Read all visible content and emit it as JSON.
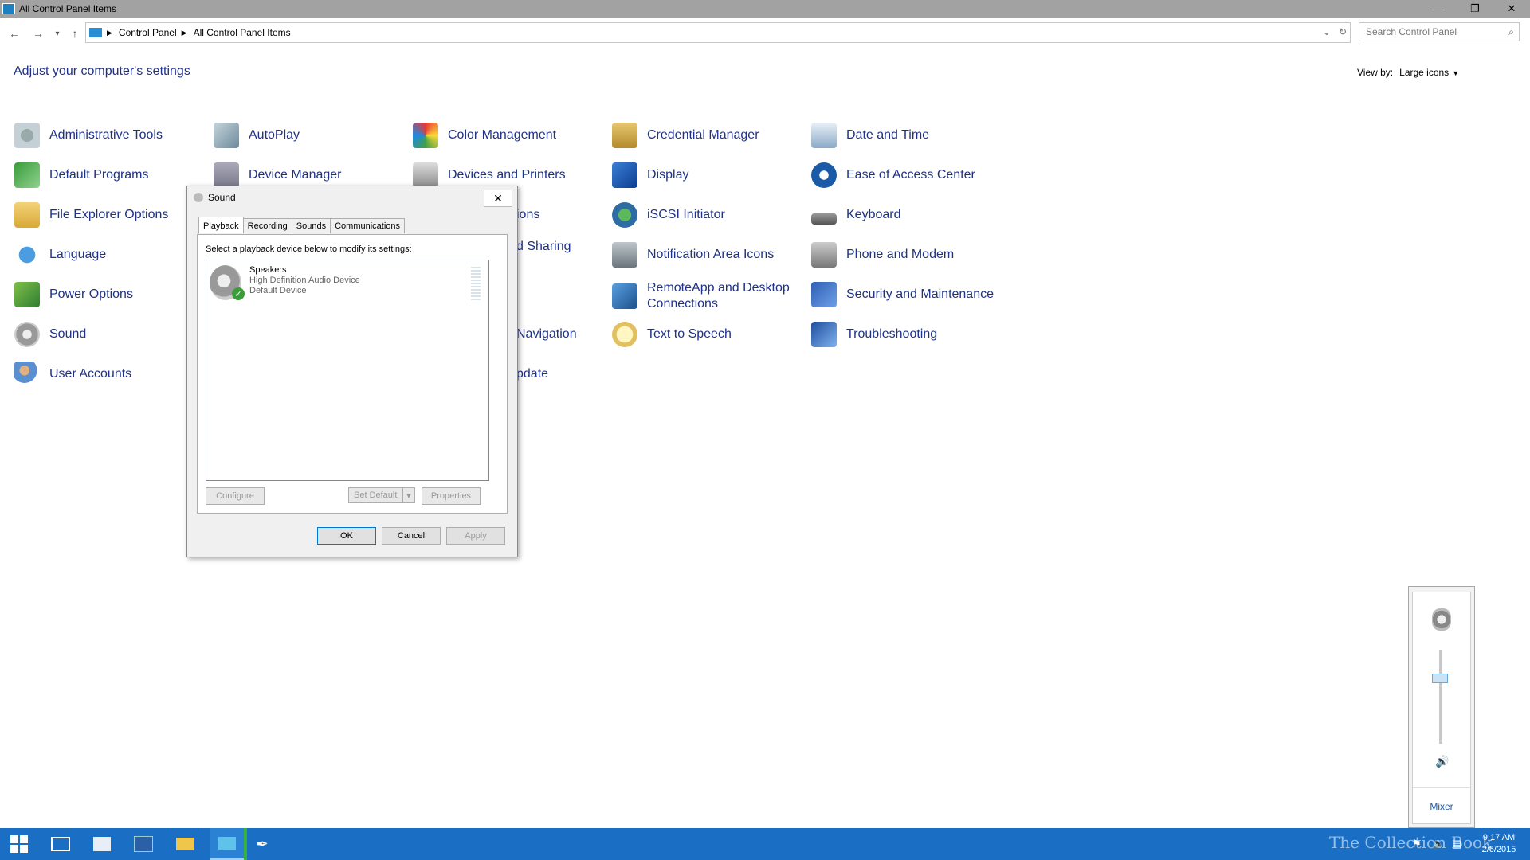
{
  "window": {
    "title": "All Control Panel Items",
    "minimize": "—",
    "restore": "❐",
    "close": "✕"
  },
  "nav": {
    "back": "←",
    "forward": "→",
    "recent": "▾",
    "up": "↑"
  },
  "address": {
    "crumbs": [
      "Control Panel",
      "All Control Panel Items"
    ],
    "dropdown": "⌄",
    "refresh": "↻"
  },
  "search": {
    "placeholder": "Search Control Panel",
    "icon": "⌕"
  },
  "header": {
    "title": "Adjust your computer's settings",
    "view_by_label": "View by:",
    "view_by_value": "Large icons",
    "caret": "▼"
  },
  "items": {
    "administrative_tools": "Administrative Tools",
    "autoplay": "AutoPlay",
    "color_management": "Color Management",
    "credential_manager": "Credential Manager",
    "date_time": "Date and Time",
    "default_programs": "Default Programs",
    "device_manager": "Device Manager",
    "devices_printers": "Devices and Printers",
    "display": "Display",
    "ease_access": "Ease of Access Center",
    "file_explorer_options": "File Explorer Options",
    "partial_options": "ions",
    "iscsi": "iSCSI Initiator",
    "keyboard": "Keyboard",
    "language": "Language",
    "partial_sharing": "d Sharing",
    "notification_icons": "Notification Area Icons",
    "phone_modem": "Phone and Modem",
    "power_options": "Power Options",
    "remoteapp_line1": "RemoteApp and Desktop",
    "remoteapp_line2": "Connections",
    "security_maintenance": "Security and Maintenance",
    "sound": "Sound",
    "partial_navigation": "Navigation",
    "text_to_speech": "Text to Speech",
    "troubleshooting": "Troubleshooting",
    "user_accounts": "User Accounts",
    "partial_update": "pdate"
  },
  "dialog": {
    "title": "Sound",
    "close": "✕",
    "tabs": [
      "Playback",
      "Recording",
      "Sounds",
      "Communications"
    ],
    "instruction": "Select a playback device below to modify its settings:",
    "device": {
      "name": "Speakers",
      "driver": "High Definition Audio Device",
      "status": "Default Device",
      "check": "✓"
    },
    "configure": "Configure",
    "set_default": "Set Default",
    "set_default_arrow": "▾",
    "properties": "Properties",
    "ok": "OK",
    "cancel": "Cancel",
    "apply": "Apply"
  },
  "volume": {
    "level_fraction": 0.72,
    "speaker_glyph": "🔊",
    "mixer": "Mixer"
  },
  "taskbar": {
    "watermark": "The Collection Book",
    "time": "9:17 AM",
    "date": "2/6/2015",
    "flag_icon": "⚑",
    "volume_icon": "🔈",
    "notifications_icon": "▤"
  }
}
